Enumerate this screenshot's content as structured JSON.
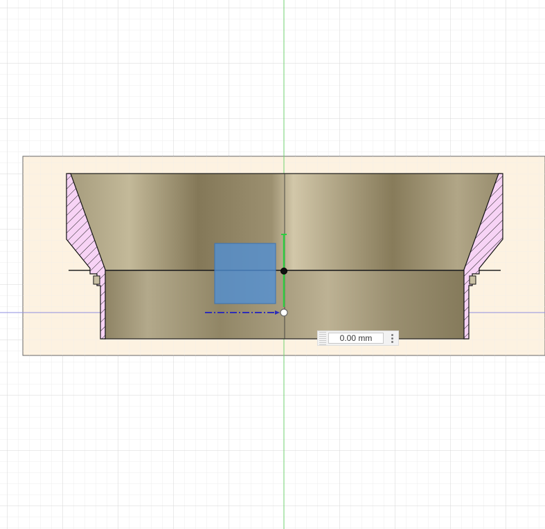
{
  "colors": {
    "canvas_background": "#ffffff",
    "grid_minor": "#ececec",
    "grid_major": "#d6d6d6",
    "sketch_plane": "#fdf2e1",
    "axis_vertical": "#5fcf5f",
    "axis_horizontal": "#8e8ee0",
    "section_hatch_fill": "#f7d3f5",
    "body_shade_dark": "#877b5a",
    "body_shade_light": "#cfc4a6",
    "selection_box": "#4f8fd6",
    "dimension_line": "#2d2db8",
    "dimension_point": "#ffffff"
  },
  "dimension_input": {
    "value": "0.00 mm",
    "menu_icon": "vertical-ellipsis-icon",
    "grip_icon": "drag-grip-icon"
  }
}
